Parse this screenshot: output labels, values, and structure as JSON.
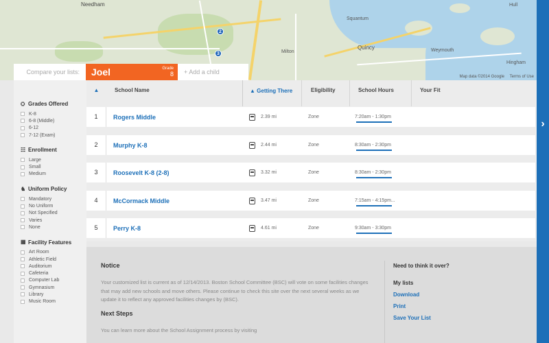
{
  "map": {
    "labels": {
      "needham": "Needham",
      "quincy": "Quincy",
      "milton": "Milton",
      "weymouth": "Weymouth",
      "hingham": "Hingham",
      "hull": "Hull",
      "squantum": "Squantum"
    },
    "pins": [
      "2",
      "3"
    ],
    "credits": "Map data ©2014 Google",
    "terms": "Terms of Use"
  },
  "compare": {
    "label": "Compare your lists:",
    "child_name": "Joel",
    "grade_label": "Grade",
    "grade_value": "8",
    "add_child": "+ Add a child"
  },
  "filters": [
    {
      "title": "Grades Offered",
      "icon": "graduation-icon",
      "options": [
        "K-8",
        "6-8 (Middle)",
        "6-12",
        "7-12 (Exam)"
      ]
    },
    {
      "title": "Enrollment",
      "icon": "people-icon",
      "options": [
        "Large",
        "Small",
        "Medium"
      ]
    },
    {
      "title": "Uniform Policy",
      "icon": "shirt-icon",
      "options": [
        "Mandatory",
        "No Uniform",
        "Not Specified",
        "Varies",
        "None"
      ]
    },
    {
      "title": "Facility Features",
      "icon": "building-icon",
      "options": [
        "Art Room",
        "Athletic Field",
        "Auditorium",
        "Cafeteria",
        "Computer Lab",
        "Gymnasium",
        "Library",
        "Music Room"
      ]
    }
  ],
  "table": {
    "headers": {
      "sort": "▲",
      "name": "School Name",
      "getting_there_arrow": "▲",
      "getting_there": "Getting There",
      "eligibility": "Eligibility",
      "hours": "School Hours",
      "fit": "Your Fit"
    },
    "rows": [
      {
        "num": "1",
        "name": "Rogers Middle",
        "distance": "2.39 mi",
        "eligibility": "Zone",
        "hours": "7:20am - 1:30pm"
      },
      {
        "num": "2",
        "name": "Murphy K-8",
        "distance": "2.44 mi",
        "eligibility": "Zone",
        "hours": "8:30am - 2:30pm"
      },
      {
        "num": "3",
        "name": "Roosevelt K-8 (2-8)",
        "distance": "3.32 mi",
        "eligibility": "Zone",
        "hours": "8:30am - 2:30pm"
      },
      {
        "num": "4",
        "name": "McCormack Middle",
        "distance": "3.47 mi",
        "eligibility": "Zone",
        "hours": "7:15am - 4:15pm..."
      },
      {
        "num": "5",
        "name": "Perry K-8",
        "distance": "4.61 mi",
        "eligibility": "Zone",
        "hours": "9:30am - 3:30pm"
      }
    ]
  },
  "notice": {
    "title": "Notice",
    "body": "Your customized list is current as of 12/14/2013. Boston School Committee (BSC) will vote on some facilities changes that may add new schools and move others. Please continue to check this site over the next several weeks as we update it to reflect any approved facilities changes by (BSC).",
    "next_title": "Next Steps",
    "next_body": "You can learn more about the School Assignment process by visiting"
  },
  "side": {
    "question": "Need to think it over?",
    "my_lists": "My lists",
    "links": [
      "Download",
      "Print",
      "Save Your List"
    ]
  },
  "nav": {
    "next_arrow": "›"
  },
  "colors": {
    "accent": "#1c6fb8",
    "child_tab": "#f26522"
  }
}
